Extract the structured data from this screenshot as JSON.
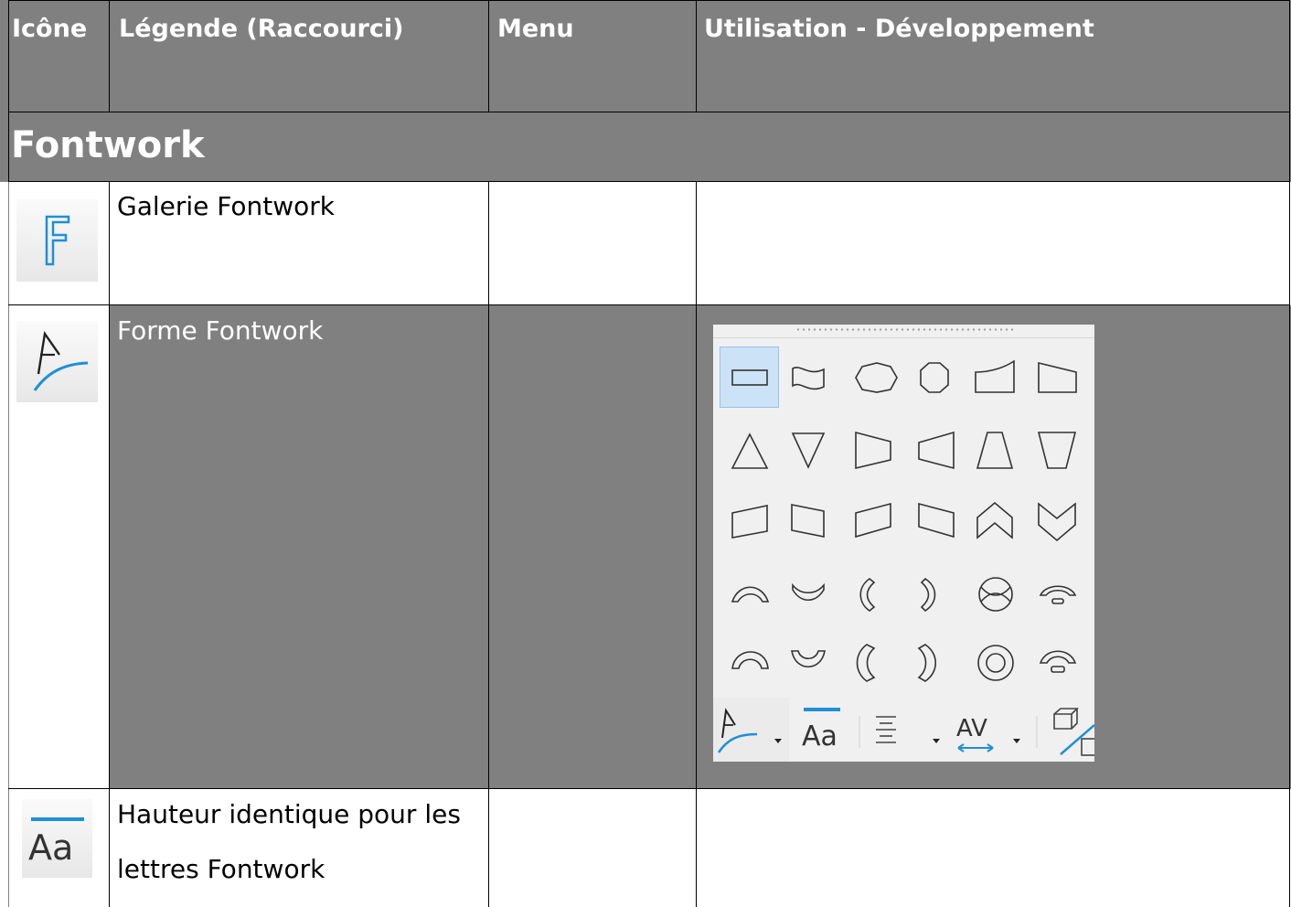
{
  "header": {
    "col_icon": "Icône",
    "col_caption": "Légende (Raccourci)",
    "col_menu": "Menu",
    "col_usage": "Utilisation  - Développement"
  },
  "section": {
    "title": "Fontwork"
  },
  "rows": [
    {
      "caption": "Galerie Fontwork",
      "icon": "fontwork-gallery-icon",
      "menu": "",
      "usage": ""
    },
    {
      "caption": "Forme Fontwork",
      "icon": "fontwork-shape-icon",
      "menu": "",
      "usage_image": "fontwork-shape-palette"
    },
    {
      "caption_line1": "Hauteur identique pour les",
      "caption_line2": "lettres Fontwork",
      "icon": "fontwork-same-letter-heights-icon",
      "menu": "",
      "usage": ""
    }
  ],
  "palette": {
    "shapes": [
      [
        "plain-text",
        "wave",
        "octagon-stop",
        "octagon",
        "curve-up",
        "curve-down"
      ],
      [
        "triangle-up",
        "triangle-down",
        "fade-right",
        "fade-left",
        "fade-up",
        "fade-down"
      ],
      [
        "slant-up",
        "slant-down",
        "fade-upright",
        "fade-upleft",
        "chevron-up",
        "chevron-down"
      ],
      [
        "arch-up-curve",
        "arch-down-curve",
        "arch-left-curve",
        "arch-right-curve",
        "circle-curve",
        "open-circle-curve"
      ],
      [
        "arch-up-pour",
        "arch-down-pour",
        "arch-left-pour",
        "arch-right-pour",
        "circle-pour",
        "open-circle-pour"
      ]
    ],
    "toolbar_icons": [
      "fontwork-shape-icon",
      "dropdown-arrow-icon",
      "same-letter-heights-icon",
      "alignment-icon",
      "dropdown-arrow-icon",
      "character-spacing-icon",
      "dropdown-arrow-icon",
      "toggle-extrusion-icon"
    ],
    "toolbar_glyph_aa": "Aa",
    "toolbar_glyph_av": "AV"
  },
  "colors": {
    "header_bg": "#808080",
    "row_highlight": "#808080",
    "icon_blue": "#1f8fd6",
    "grid": "#000000"
  }
}
